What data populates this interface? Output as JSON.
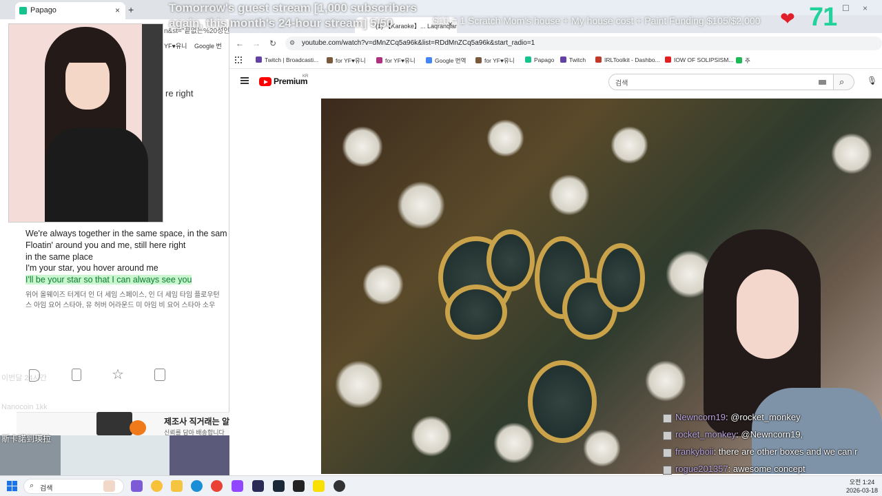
{
  "overlay": {
    "title_line1": "Tomorrow's guest stream [1,000 subscribers",
    "title_line2": "again, this month's 24-hour stream] 5/50",
    "funding": "$10 = 1 Scratch Mom's house + My house cost + Paint Funding $105/$2,000",
    "heart_count": "71"
  },
  "papago": {
    "tab_label": "Papago",
    "tab_close": "×",
    "new_tab": "+",
    "url_fragment": "n&st=\"끝없는%20성인널",
    "bookmark_1": "YF♥유니",
    "bookmark_2": "Google 번",
    "partial_line": "re right",
    "lyrics": [
      "We're always together in the same space, in the sam",
      "Floatin' around you and me, still here right",
      "in the same place",
      "I'm your star, you hover around me"
    ],
    "lyrics_highlight": "I'll be your star so that I can always see you",
    "korean": [
      "위어 올웨이즈 터게더 인 더 세임 스페이스, 인 더 세임 타임 플로우턴",
      "스 아임 요어 스타아, 유 허버 어라운드 미 아임 비 요어 스타아 소우"
    ],
    "ad_title": "제조사 직거래는 알",
    "ad_sub": "신뢰를 담아 배송합니다"
  },
  "browser": {
    "tab_label": "(1) 【Karaoke】... Laqranqian...",
    "tab_close": "×",
    "url": "youtube.com/watch?v=dMnZCq5a96k&list=RDdMnZCq5a96k&start_radio=1",
    "bookmarks": [
      {
        "label": "Twitch | Broadcasti...",
        "color": "#6441a5"
      },
      {
        "label": "for YF♥유니",
        "color": "#7a5a3a"
      },
      {
        "label": "for YF♥유니",
        "color": "#b03080"
      },
      {
        "label": "Google 번역",
        "color": "#4285f4"
      },
      {
        "label": "for YF♥유니",
        "color": "#7a5a3a"
      },
      {
        "label": "Papago",
        "color": "#14c38e"
      },
      {
        "label": "Twitch",
        "color": "#6441a5"
      },
      {
        "label": "IRLToolkit - Dashbo...",
        "color": "#c0392b"
      },
      {
        "label": "IOW OF SOLIPSISM...",
        "color": "#e02020"
      },
      {
        "label": "주",
        "color": "#1db954"
      }
    ],
    "nav_back": "←",
    "nav_forward": "→",
    "nav_reload": "↻",
    "minimize": "–",
    "maximize": "☐",
    "close": "×"
  },
  "youtube": {
    "brand": "Premium",
    "region": "KR",
    "search_placeholder": "검색"
  },
  "chat": [
    {
      "user": "Newncorn19",
      "message": "@rocket_monkey"
    },
    {
      "user": "rocket_monkey",
      "message": "@Newncorn19,"
    },
    {
      "user": "frankyboii",
      "message": "there are other boxes and we can r"
    },
    {
      "user": "rogue201357",
      "message": "awesome concept"
    }
  ],
  "sidebar_ghost": {
    "line1": "이번달 24시간",
    "line2": "Nanocoin 1kk"
  },
  "stream_caption": "斯卡諾到瑛拉",
  "taskbar": {
    "search_placeholder": "검색",
    "time": "오전 1:24",
    "date": "2026-03-18"
  }
}
